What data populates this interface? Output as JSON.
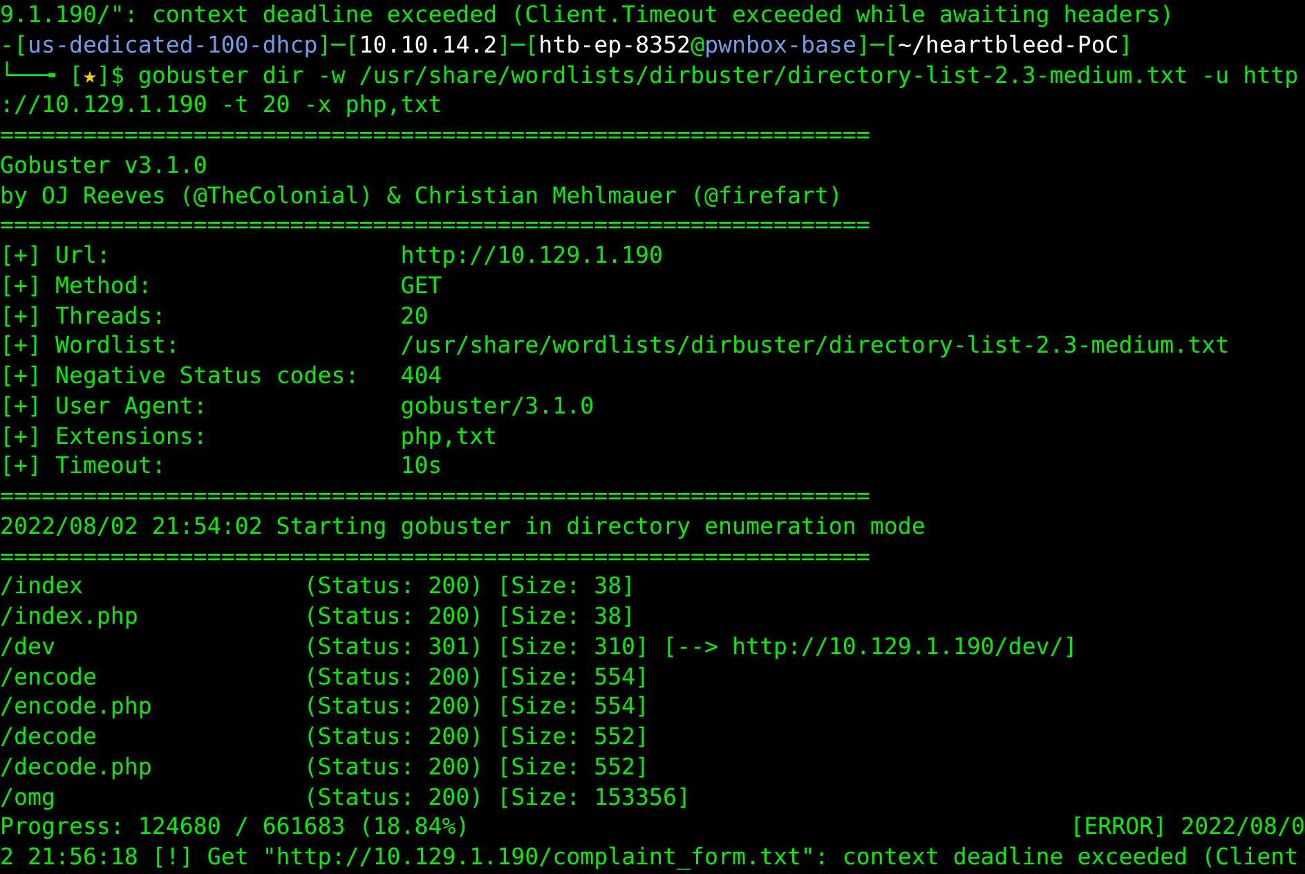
{
  "terminal": {
    "previous_output": "9.1.190/\": context deadline exceeded (Client.Timeout exceeded while awaiting headers)",
    "prompt": [
      {
        "kind": "frame",
        "text": "-["
      },
      {
        "kind": "name",
        "text": "us-dedicated-100-dhcp"
      },
      {
        "kind": "frame",
        "text": "]─["
      },
      {
        "kind": "plain",
        "text": "10.10.14.2"
      },
      {
        "kind": "frame",
        "text": "]─["
      },
      {
        "kind": "plain",
        "text": "htb-ep-8352"
      },
      {
        "kind": "frame",
        "text": "@"
      },
      {
        "kind": "name",
        "text": "pwnbox-base"
      },
      {
        "kind": "frame",
        "text": "]─["
      },
      {
        "kind": "plain",
        "text": "~/heartbleed-PoC"
      },
      {
        "kind": "frame",
        "text": "]"
      }
    ],
    "command_prompt": [
      {
        "kind": "frame",
        "text": "└──╼ ["
      },
      {
        "kind": "star",
        "text": "★"
      },
      {
        "kind": "frame",
        "text": "]$"
      }
    ],
    "command": "gobuster dir -w /usr/share/wordlists/dirbuster/directory-list-2.3-medium.txt -u http",
    "command_continued": "://10.129.1.190 -t 20 -x php,txt",
    "separator": "===============================================================",
    "banner": [
      "Gobuster v3.1.0",
      "by OJ Reeves (@TheColonial) & Christian Mehlmauer (@firefart)"
    ],
    "config": [
      {
        "label": "[+] Url:",
        "value": "http://10.129.1.190"
      },
      {
        "label": "[+] Method:",
        "value": "GET"
      },
      {
        "label": "[+] Threads:",
        "value": "20"
      },
      {
        "label": "[+] Wordlist:",
        "value": "/usr/share/wordlists/dirbuster/directory-list-2.3-medium.txt"
      },
      {
        "label": "[+] Negative Status codes:",
        "value": "404"
      },
      {
        "label": "[+] User Agent:",
        "value": "gobuster/3.1.0"
      },
      {
        "label": "[+] Extensions:",
        "value": "php,txt"
      },
      {
        "label": "[+] Timeout:",
        "value": "10s"
      }
    ],
    "start_message": "2022/08/02 21:54:02 Starting gobuster in directory enumeration mode",
    "results": [
      {
        "path": "/index",
        "status": "(Status: 200)",
        "size": "[Size: 38]"
      },
      {
        "path": "/index.php",
        "status": "(Status: 200)",
        "size": "[Size: 38]"
      },
      {
        "path": "/dev",
        "status": "(Status: 301)",
        "size": "[Size: 310]",
        "redirect": "[--> http://10.129.1.190/dev/]"
      },
      {
        "path": "/encode",
        "status": "(Status: 200)",
        "size": "[Size: 554]"
      },
      {
        "path": "/encode.php",
        "status": "(Status: 200)",
        "size": "[Size: 554]"
      },
      {
        "path": "/decode",
        "status": "(Status: 200)",
        "size": "[Size: 552]"
      },
      {
        "path": "/decode.php",
        "status": "(Status: 200)",
        "size": "[Size: 552]"
      },
      {
        "path": "/omg",
        "status": "(Status: 200)",
        "size": "[Size: 153356]"
      }
    ],
    "progress": "Progress: 124680 / 661683 (18.84%)",
    "error_start": "[ERROR] 2022/08/0",
    "error_continued": "2 21:56:18 [!] Get \"http://10.129.1.190/complaint_form.txt\": context deadline exceeded (Client"
  }
}
